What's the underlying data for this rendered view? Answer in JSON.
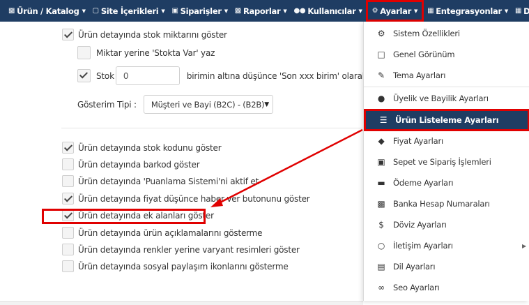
{
  "navbar": {
    "items": [
      {
        "label": "Ürün / Katalog",
        "icon": "cubes-icon"
      },
      {
        "label": "Site İçerikleri",
        "icon": "file-icon"
      },
      {
        "label": "Siparişler",
        "icon": "cart-icon"
      },
      {
        "label": "Raporlar",
        "icon": "chart-icon"
      },
      {
        "label": "Kullanıcılar",
        "icon": "users-icon"
      },
      {
        "label": "Ayarlar",
        "icon": "gears-icon"
      },
      {
        "label": "Entegrasyonlar",
        "icon": "sitemap-icon"
      },
      {
        "label": "D",
        "icon": "grid-icon"
      }
    ]
  },
  "settings": {
    "stock_show": "Ürün detayında stok miktarını göster",
    "stock_instead": "Miktar yerine 'Stokta Var' yaz",
    "stock_prefix": "Stok",
    "stock_value": "0",
    "stock_suffix": "birimin altına düşünce 'Son xxx birim' olarak göst",
    "display_type_label": "Gösterim Tipi :",
    "display_type_value": "Müşteri ve Bayi (B2C) - (B2B)",
    "options": [
      "Ürün detayında stok kodunu göster",
      "Ürün detayında barkod göster",
      "Ürün detayında 'Puanlama Sistemi'ni aktif et",
      "Ürün detayında fiyat düşünce haber ver butonunu göster",
      "Ürün detayında ek alanları göster",
      "Ürün detayında ürün açıklamalarını gösterme",
      "Ürün detayında renkler yerine varyant resimleri göster",
      "Ürün detayında sosyal paylaşım ikonlarını gösterme"
    ]
  },
  "dropdown": {
    "items": [
      {
        "label": "Sistem Özellikleri",
        "icon": "gears-icon"
      },
      {
        "label": "Genel Görünüm",
        "icon": "monitor-icon"
      },
      {
        "label": "Tema Ayarları",
        "icon": "brush-icon"
      },
      {
        "label": "Üyelik ve Bayilik Ayarları",
        "icon": "users-icon"
      },
      {
        "label": "Ürün Listeleme Ayarları",
        "icon": "list-icon"
      },
      {
        "label": "Fiyat Ayarları",
        "icon": "tag-icon"
      },
      {
        "label": "Sepet ve Sipariş İşlemleri",
        "icon": "basket-icon"
      },
      {
        "label": "Ödeme Ayarları",
        "icon": "card-icon"
      },
      {
        "label": "Banka Hesap Numaraları",
        "icon": "bank-icon"
      },
      {
        "label": "Döviz Ayarları",
        "icon": "dollar-icon"
      },
      {
        "label": "İletişim Ayarları",
        "icon": "chat-icon"
      },
      {
        "label": "Dil Ayarları",
        "icon": "language-icon"
      },
      {
        "label": "Seo Ayarları",
        "icon": "link-icon"
      }
    ]
  },
  "colors": {
    "navbar": "#1f3d63",
    "highlight": "#e00000"
  }
}
